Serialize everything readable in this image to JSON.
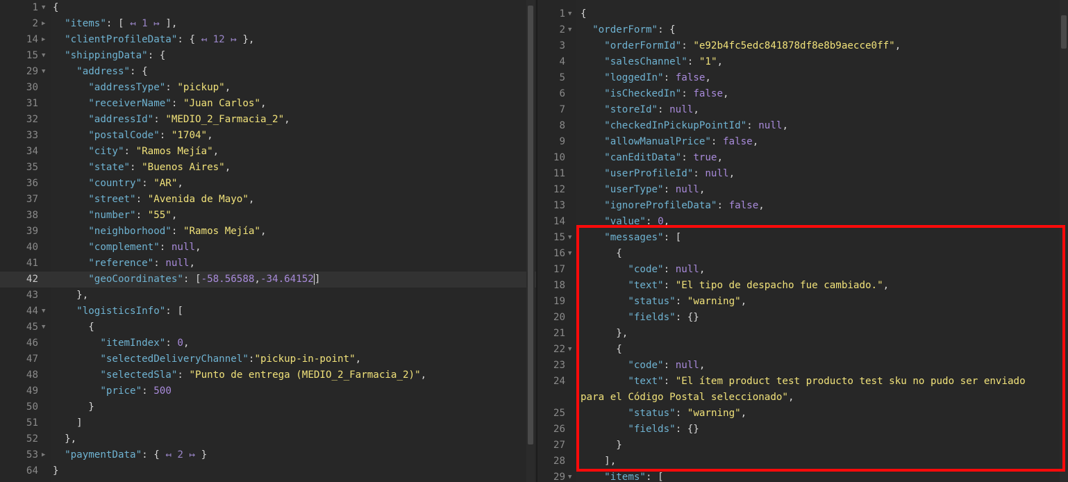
{
  "left_editor": {
    "lines": [
      {
        "n": "1",
        "fold": "▼",
        "html": "<span class='p'>{</span>"
      },
      {
        "n": "2",
        "fold": "▶",
        "html": "  <span class='k'>\"items\"</span><span class='p'>: [ </span><span class='fd'>↤ 1 ↦</span><span class='p'> ],</span>"
      },
      {
        "n": "14",
        "fold": "▶",
        "html": "  <span class='k'>\"clientProfileData\"</span><span class='p'>: { </span><span class='fd'>↤ 12 ↦</span><span class='p'> },</span>"
      },
      {
        "n": "15",
        "fold": "▼",
        "html": "  <span class='k'>\"shippingData\"</span><span class='p'>: {</span>"
      },
      {
        "n": "29",
        "fold": "▼",
        "html": "    <span class='k'>\"address\"</span><span class='p'>: {</span>"
      },
      {
        "n": "30",
        "fold": "",
        "html": "      <span class='k'>\"addressType\"</span><span class='p'>: </span><span class='s'>\"pickup\"</span><span class='p'>,</span>"
      },
      {
        "n": "31",
        "fold": "",
        "html": "      <span class='k'>\"receiverName\"</span><span class='p'>: </span><span class='s'>\"Juan Carlos\"</span><span class='p'>,</span>"
      },
      {
        "n": "32",
        "fold": "",
        "html": "      <span class='k'>\"addressId\"</span><span class='p'>: </span><span class='s'>\"MEDIO_2_Farmacia_2\"</span><span class='p'>,</span>"
      },
      {
        "n": "33",
        "fold": "",
        "html": "      <span class='k'>\"postalCode\"</span><span class='p'>: </span><span class='s'>\"1704\"</span><span class='p'>,</span>"
      },
      {
        "n": "34",
        "fold": "",
        "html": "      <span class='k'>\"city\"</span><span class='p'>: </span><span class='s'>\"Ramos Mejía\"</span><span class='p'>,</span>"
      },
      {
        "n": "35",
        "fold": "",
        "html": "      <span class='k'>\"state\"</span><span class='p'>: </span><span class='s'>\"Buenos Aires\"</span><span class='p'>,</span>"
      },
      {
        "n": "36",
        "fold": "",
        "html": "      <span class='k'>\"country\"</span><span class='p'>: </span><span class='s'>\"AR\"</span><span class='p'>,</span>"
      },
      {
        "n": "37",
        "fold": "",
        "html": "      <span class='k'>\"street\"</span><span class='p'>: </span><span class='s'>\"Avenida de Mayo\"</span><span class='p'>,</span>"
      },
      {
        "n": "38",
        "fold": "",
        "html": "      <span class='k'>\"number\"</span><span class='p'>: </span><span class='s'>\"55\"</span><span class='p'>,</span>"
      },
      {
        "n": "39",
        "fold": "",
        "html": "      <span class='k'>\"neighborhood\"</span><span class='p'>: </span><span class='s'>\"Ramos Mejía\"</span><span class='p'>,</span>"
      },
      {
        "n": "40",
        "fold": "",
        "html": "      <span class='k'>\"complement\"</span><span class='p'>: </span><span class='b'>null</span><span class='p'>,</span>"
      },
      {
        "n": "41",
        "fold": "",
        "html": "      <span class='k'>\"reference\"</span><span class='p'>: </span><span class='b'>null</span><span class='p'>,</span>"
      },
      {
        "n": "42",
        "fold": "",
        "active": true,
        "html": "      <span class='k'>\"geoCoordinates\"</span><span class='p'>: [</span><span class='n'>-58.56588</span><span class='p'>,</span><span class='n'>-34.64152</span><span class='p cursor'>]</span>"
      },
      {
        "n": "43",
        "fold": "",
        "html": "    <span class='p'>},</span>"
      },
      {
        "n": "44",
        "fold": "▼",
        "html": "    <span class='k'>\"logisticsInfo\"</span><span class='p'>: [</span>"
      },
      {
        "n": "45",
        "fold": "▼",
        "html": "      <span class='p'>{</span>"
      },
      {
        "n": "46",
        "fold": "",
        "html": "        <span class='k'>\"itemIndex\"</span><span class='p'>: </span><span class='n'>0</span><span class='p'>,</span>"
      },
      {
        "n": "47",
        "fold": "",
        "html": "        <span class='k'>\"selectedDeliveryChannel\"</span><span class='p'>:</span><span class='s'>\"pickup-in-point\"</span><span class='p'>,</span>"
      },
      {
        "n": "48",
        "fold": "",
        "html": "        <span class='k'>\"selectedSla\"</span><span class='p'>: </span><span class='s'>\"Punto de entrega (MEDIO_2_Farmacia_2)\"</span><span class='p'>,</span>"
      },
      {
        "n": "49",
        "fold": "",
        "html": "        <span class='k'>\"price\"</span><span class='p'>: </span><span class='n'>500</span>"
      },
      {
        "n": "50",
        "fold": "",
        "html": "      <span class='p'>}</span>"
      },
      {
        "n": "51",
        "fold": "",
        "html": "    <span class='p'>]</span>"
      },
      {
        "n": "52",
        "fold": "",
        "html": "  <span class='p'>},</span>"
      },
      {
        "n": "53",
        "fold": "▶",
        "html": "  <span class='k'>\"paymentData\"</span><span class='p'>: { </span><span class='fd'>↤ 2 ↦</span><span class='p'> }</span>"
      },
      {
        "n": "64",
        "fold": "",
        "html": "<span class='p'>}</span>"
      }
    ]
  },
  "right_editor": {
    "lines": [
      {
        "n": "1",
        "fold": "▼",
        "html": "<span class='p'>{</span>"
      },
      {
        "n": "2",
        "fold": "▼",
        "html": "  <span class='k'>\"orderForm\"</span><span class='p'>: {</span>"
      },
      {
        "n": "3",
        "fold": "",
        "html": "    <span class='k'>\"orderFormId\"</span><span class='p'>: </span><span class='s'>\"e92b4fc5edc841878df8e8b9aecce0ff\"</span><span class='p'>,</span>"
      },
      {
        "n": "4",
        "fold": "",
        "html": "    <span class='k'>\"salesChannel\"</span><span class='p'>: </span><span class='s'>\"1\"</span><span class='p'>,</span>"
      },
      {
        "n": "5",
        "fold": "",
        "html": "    <span class='k'>\"loggedIn\"</span><span class='p'>: </span><span class='b'>false</span><span class='p'>,</span>"
      },
      {
        "n": "6",
        "fold": "",
        "html": "    <span class='k'>\"isCheckedIn\"</span><span class='p'>: </span><span class='b'>false</span><span class='p'>,</span>"
      },
      {
        "n": "7",
        "fold": "",
        "html": "    <span class='k'>\"storeId\"</span><span class='p'>: </span><span class='b'>null</span><span class='p'>,</span>"
      },
      {
        "n": "8",
        "fold": "",
        "html": "    <span class='k'>\"checkedInPickupPointId\"</span><span class='p'>: </span><span class='b'>null</span><span class='p'>,</span>"
      },
      {
        "n": "9",
        "fold": "",
        "html": "    <span class='k'>\"allowManualPrice\"</span><span class='p'>: </span><span class='b'>false</span><span class='p'>,</span>"
      },
      {
        "n": "10",
        "fold": "",
        "html": "    <span class='k'>\"canEditData\"</span><span class='p'>: </span><span class='b'>true</span><span class='p'>,</span>"
      },
      {
        "n": "11",
        "fold": "",
        "html": "    <span class='k'>\"userProfileId\"</span><span class='p'>: </span><span class='b'>null</span><span class='p'>,</span>"
      },
      {
        "n": "12",
        "fold": "",
        "html": "    <span class='k'>\"userType\"</span><span class='p'>: </span><span class='b'>null</span><span class='p'>,</span>"
      },
      {
        "n": "13",
        "fold": "",
        "html": "    <span class='k'>\"ignoreProfileData\"</span><span class='p'>: </span><span class='b'>false</span><span class='p'>,</span>"
      },
      {
        "n": "14",
        "fold": "",
        "html": "    <span class='k'>\"value\"</span><span class='p'>: </span><span class='n'>0</span><span class='p'>,</span>"
      },
      {
        "n": "15",
        "fold": "▼",
        "html": "    <span class='k'>\"messages\"</span><span class='p'>: [</span>"
      },
      {
        "n": "16",
        "fold": "▼",
        "html": "      <span class='p'>{</span>"
      },
      {
        "n": "17",
        "fold": "",
        "html": "        <span class='k'>\"code\"</span><span class='p'>: </span><span class='b'>null</span><span class='p'>,</span>"
      },
      {
        "n": "18",
        "fold": "",
        "html": "        <span class='k'>\"text\"</span><span class='p'>: </span><span class='s'>\"El tipo de despacho fue cambiado.\"</span><span class='p'>,</span>"
      },
      {
        "n": "19",
        "fold": "",
        "html": "        <span class='k'>\"status\"</span><span class='p'>: </span><span class='s'>\"warning\"</span><span class='p'>,</span>"
      },
      {
        "n": "20",
        "fold": "",
        "html": "        <span class='k'>\"fields\"</span><span class='p'>: {}</span>"
      },
      {
        "n": "21",
        "fold": "",
        "html": "      <span class='p'>},</span>"
      },
      {
        "n": "22",
        "fold": "▼",
        "html": "      <span class='p'>{</span>"
      },
      {
        "n": "23",
        "fold": "",
        "html": "        <span class='k'>\"code\"</span><span class='p'>: </span><span class='b'>null</span><span class='p'>,</span>"
      },
      {
        "n": "24",
        "fold": "",
        "wrap": "para el Código Postal seleccionado\"<span class='p'>,</span>",
        "html": "        <span class='k'>\"text\"</span><span class='p'>: </span><span class='s'>\"El ítem product test producto test sku no pudo ser enviado</span>"
      },
      {
        "n": "25",
        "fold": "",
        "html": "        <span class='k'>\"status\"</span><span class='p'>: </span><span class='s'>\"warning\"</span><span class='p'>,</span>"
      },
      {
        "n": "26",
        "fold": "",
        "html": "        <span class='k'>\"fields\"</span><span class='p'>: {}</span>"
      },
      {
        "n": "27",
        "fold": "",
        "html": "      <span class='p'>}</span>"
      },
      {
        "n": "28",
        "fold": "",
        "html": "    <span class='p'>],</span>"
      },
      {
        "n": "29",
        "fold": "▼",
        "html": "    <span class='k'>\"items\"</span><span class='p'>: [</span>"
      }
    ]
  }
}
